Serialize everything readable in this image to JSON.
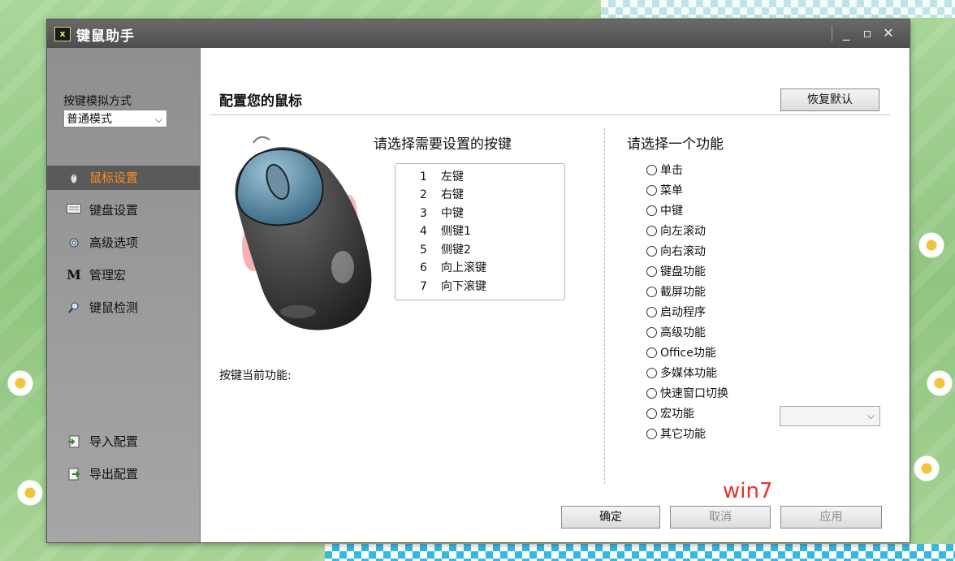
{
  "window": {
    "title": "键鼠助手",
    "app_icon_text": "x",
    "controls": {
      "minimize": "_",
      "maximize": "▫",
      "close": "✕"
    }
  },
  "sidebar": {
    "mode_label": "按键模拟方式",
    "mode_value": "普通模式",
    "items": [
      {
        "label": "鼠标设置",
        "icon": "mouse-icon",
        "active": true
      },
      {
        "label": "键盘设置",
        "icon": "keyboard-icon",
        "active": false
      },
      {
        "label": "高级选项",
        "icon": "gear-icon",
        "active": false
      },
      {
        "label": "管理宏",
        "icon": "macro-m-icon",
        "active": false
      },
      {
        "label": "键鼠检测",
        "icon": "magnifier-icon",
        "active": false
      }
    ],
    "bottom_items": [
      {
        "label": "导入配置",
        "icon": "import-icon"
      },
      {
        "label": "导出配置",
        "icon": "export-icon"
      }
    ]
  },
  "main": {
    "title": "配置您的鼠标",
    "restore_button": "恢复默认",
    "select_key_heading": "请选择需要设置的按键",
    "keys": [
      {
        "num": "1",
        "label": "左键"
      },
      {
        "num": "2",
        "label": "右键"
      },
      {
        "num": "3",
        "label": "中键"
      },
      {
        "num": "4",
        "label": "侧键1"
      },
      {
        "num": "5",
        "label": "侧键2"
      },
      {
        "num": "6",
        "label": "向上滚键"
      },
      {
        "num": "7",
        "label": "向下滚键"
      }
    ],
    "current_function_label": "按键当前功能:",
    "select_function_heading": "请选择一个功能",
    "functions": [
      "单击",
      "菜单",
      "中键",
      "向左滚动",
      "向右滚动",
      "键盘功能",
      "截屏功能",
      "启动程序",
      "高级功能",
      "Office功能",
      "多媒体功能",
      "快速窗口切换",
      "宏功能",
      "其它功能"
    ],
    "footer": {
      "ok": "确定",
      "cancel": "取消",
      "apply": "应用"
    }
  },
  "overlay_text": "win7",
  "colors": {
    "active_nav_text": "#ff8c1a",
    "titlebar": "#555555",
    "sidebar": "#9a9a9a",
    "overlay_text": "#e8322a"
  }
}
